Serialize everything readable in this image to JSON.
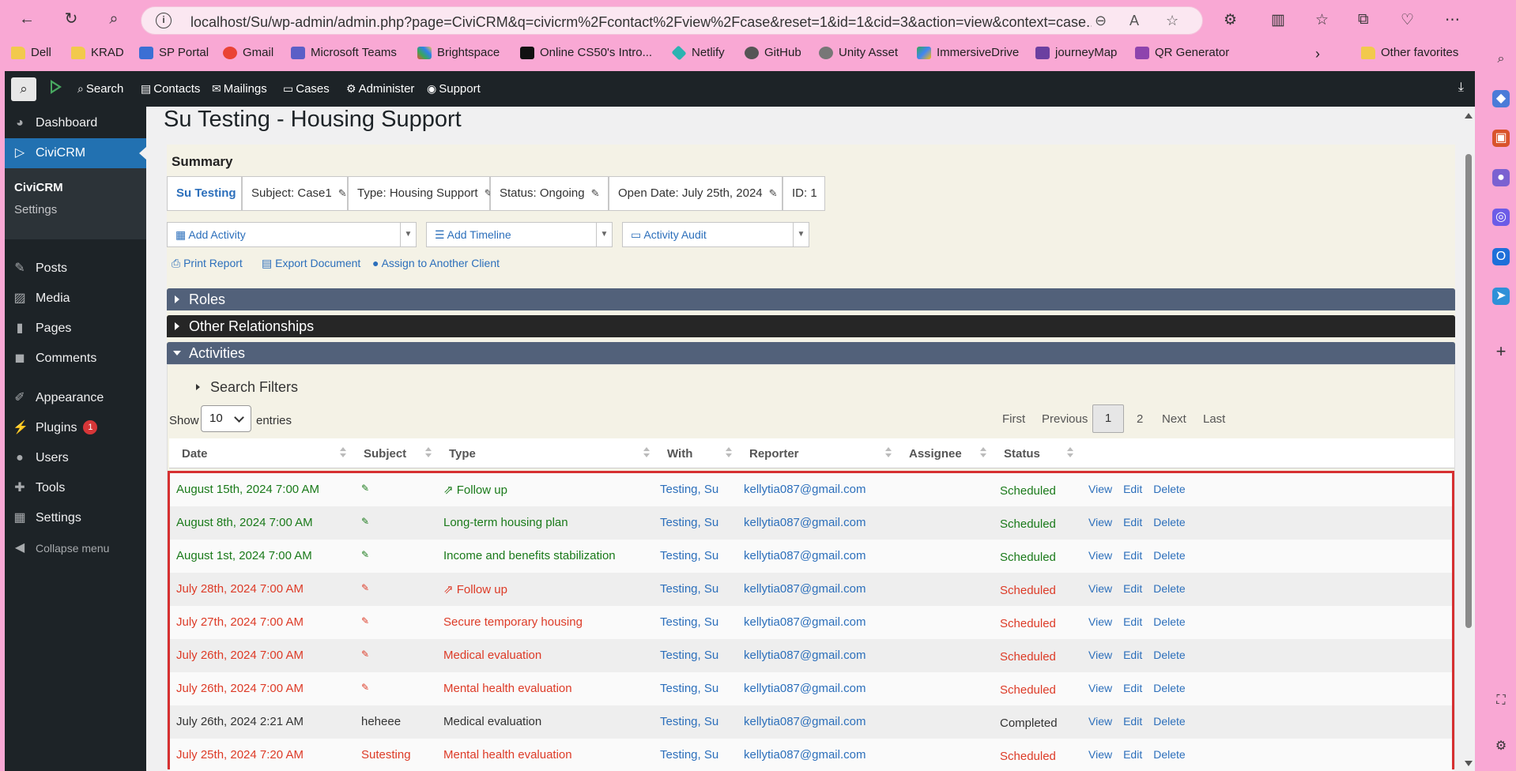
{
  "browser": {
    "url": "localhost/Su/wp-admin/admin.php?page=CiviCRM&q=civicrm%2Fcontact%2Fview%2Fcase&reset=1&id=1&cid=3&action=view&context=case...",
    "bookmarks": [
      "Dell",
      "KRAD",
      "SP Portal",
      "Gmail",
      "Microsoft Teams",
      "Brightspace",
      "Online CS50's Intro...",
      "Netlify",
      "GitHub",
      "Unity Asset",
      "ImmersiveDrive",
      "journeyMap",
      "QR Generator"
    ],
    "other_favorites": "Other favorites"
  },
  "topbar": {
    "menu": [
      "Search",
      "Contacts",
      "Mailings",
      "Cases",
      "Administer",
      "Support"
    ]
  },
  "sidebar": {
    "items": [
      "Dashboard",
      "CiviCRM",
      "Posts",
      "Media",
      "Pages",
      "Comments",
      "Appearance",
      "Plugins",
      "Users",
      "Tools",
      "Settings",
      "Collapse menu"
    ],
    "sub": [
      "CiviCRM",
      "Settings"
    ],
    "plugins_badge": "1"
  },
  "page": {
    "title": "Su Testing - Housing Support",
    "summary_label": "Summary",
    "chips": [
      "Su Testing",
      "Subject:  Case1",
      "Type: Housing Support",
      "Status: Ongoing",
      "Open Date: July 25th, 2024",
      "ID: 1"
    ],
    "selects": [
      "Add Activity",
      "Add Timeline",
      "Activity Audit"
    ],
    "links": [
      "Print Report",
      "Export Document",
      "Assign to Another Client"
    ],
    "sections": [
      "Roles",
      "Other Relationships",
      "Activities"
    ]
  },
  "activities": {
    "search_filters": "Search Filters",
    "show": "Show",
    "entries_value": "10",
    "entries": "entries",
    "pager": [
      "First",
      "Previous",
      "1",
      "2",
      "Next",
      "Last"
    ],
    "headers": [
      "Date",
      "Subject",
      "Type",
      "With",
      "Reporter",
      "Assignee",
      "Status"
    ],
    "row_actions": [
      "View",
      "Edit",
      "Delete"
    ],
    "rows": [
      {
        "date": "August 15th, 2024 7:00 AM",
        "subject": "",
        "type": "Follow up",
        "with": "Testing, Su",
        "reporter": "kellytia087@gmail.com",
        "status": "Scheduled",
        "color": "green"
      },
      {
        "date": "August 8th, 2024 7:00 AM",
        "subject": "",
        "type": "Long-term housing plan",
        "with": "Testing, Su",
        "reporter": "kellytia087@gmail.com",
        "status": "Scheduled",
        "color": "green"
      },
      {
        "date": "August 1st, 2024 7:00 AM",
        "subject": "",
        "type": "Income and benefits stabilization",
        "with": "Testing, Su",
        "reporter": "kellytia087@gmail.com",
        "status": "Scheduled",
        "color": "green"
      },
      {
        "date": "July 28th, 2024 7:00 AM",
        "subject": "",
        "type": "Follow up",
        "with": "Testing, Su",
        "reporter": "kellytia087@gmail.com",
        "status": "Scheduled",
        "color": "red"
      },
      {
        "date": "July 27th, 2024 7:00 AM",
        "subject": "",
        "type": "Secure temporary housing",
        "with": "Testing, Su",
        "reporter": "kellytia087@gmail.com",
        "status": "Scheduled",
        "color": "red"
      },
      {
        "date": "July 26th, 2024 7:00 AM",
        "subject": "",
        "type": "Medical evaluation",
        "with": "Testing, Su",
        "reporter": "kellytia087@gmail.com",
        "status": "Scheduled",
        "color": "red"
      },
      {
        "date": "July 26th, 2024 7:00 AM",
        "subject": "",
        "type": "Mental health evaluation",
        "with": "Testing, Su",
        "reporter": "kellytia087@gmail.com",
        "status": "Scheduled",
        "color": "red"
      },
      {
        "date": "July 26th, 2024 2:21 AM",
        "subject": "heheee",
        "type": "Medical evaluation",
        "with": "Testing, Su",
        "reporter": "kellytia087@gmail.com",
        "status": "Completed",
        "color": "plain"
      },
      {
        "date": "July 25th, 2024 7:20 AM",
        "subject": "Sutesting",
        "type": "Mental health evaluation",
        "with": "Testing, Su",
        "reporter": "kellytia087@gmail.com",
        "status": "Scheduled",
        "color": "red"
      }
    ]
  },
  "colors": {
    "wp_dark": "#1d2327",
    "wp_blue": "#2271b1",
    "civi_link": "#2c6fbb",
    "green_status": "#1a7a1a",
    "red_status": "#dd3b27",
    "highlight": "#d63031"
  }
}
